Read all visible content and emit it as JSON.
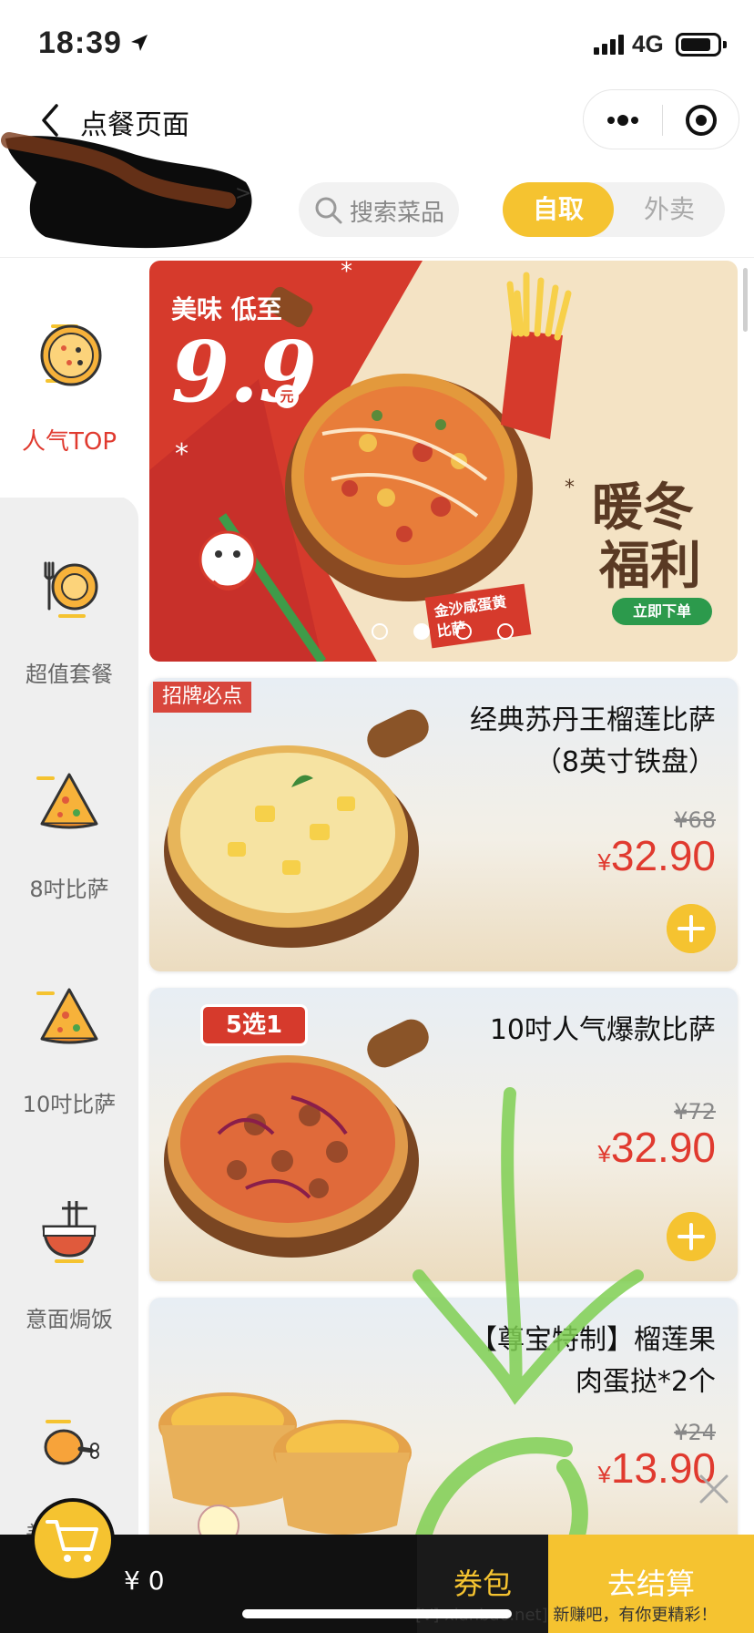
{
  "status_bar": {
    "time": "18:39",
    "network": "4G"
  },
  "nav": {
    "title": "点餐页面",
    "back_icon": "chevron-left-icon",
    "more_icon": "more-dots-icon",
    "close_icon": "target-circle-icon"
  },
  "store": {
    "chevron": ">"
  },
  "search": {
    "placeholder": "搜索菜品"
  },
  "mode": {
    "self_pickup": "自取",
    "delivery": "外卖",
    "selected": "自取"
  },
  "sidebar": {
    "items": [
      {
        "label": "人气TOP",
        "icon": "pizza-icon",
        "active": true
      },
      {
        "label": "超值套餐",
        "icon": "plate-fork-knife-icon",
        "active": false
      },
      {
        "label": "8吋比萨",
        "icon": "pizza-slice-icon",
        "active": false
      },
      {
        "label": "10吋比萨",
        "icon": "pizza-slice-icon",
        "active": false
      },
      {
        "label": "意面焗饭",
        "icon": "noodle-bowl-icon",
        "active": false
      },
      {
        "label": "美味烤鸡",
        "icon": "chicken-leg-icon",
        "active": false
      }
    ]
  },
  "banner": {
    "subtitle": "美味 低至",
    "price": "9.9",
    "unit": "元",
    "title_line1": "暖冬",
    "title_line2": "福利",
    "cta": "立即下单",
    "flavor": "金沙咸蛋黄比萨",
    "dots_count": 4,
    "active_dot": 1
  },
  "products": [
    {
      "tag": "招牌必点",
      "name": "经典苏丹王榴莲比萨（8英寸铁盘）",
      "original_price": "¥68",
      "currency": "¥",
      "price": "32.90"
    },
    {
      "badge": "5选1",
      "name": "10吋人气爆款比萨",
      "original_price": "¥72",
      "currency": "¥",
      "price": "32.90"
    },
    {
      "name": "【尊宝特制】榴莲果肉蛋挞*2个",
      "original_price": "¥24",
      "currency": "¥",
      "price": "13.90"
    }
  ],
  "bottom_bar": {
    "cart_total": "¥ 0",
    "coupon": "券包",
    "checkout": "去结算"
  },
  "watermark": "[V] xianbao.net] 新赚吧，有你更精彩！",
  "colors": {
    "accent": "#f5c330",
    "price": "#e03a2f",
    "tag": "#d8463c"
  }
}
